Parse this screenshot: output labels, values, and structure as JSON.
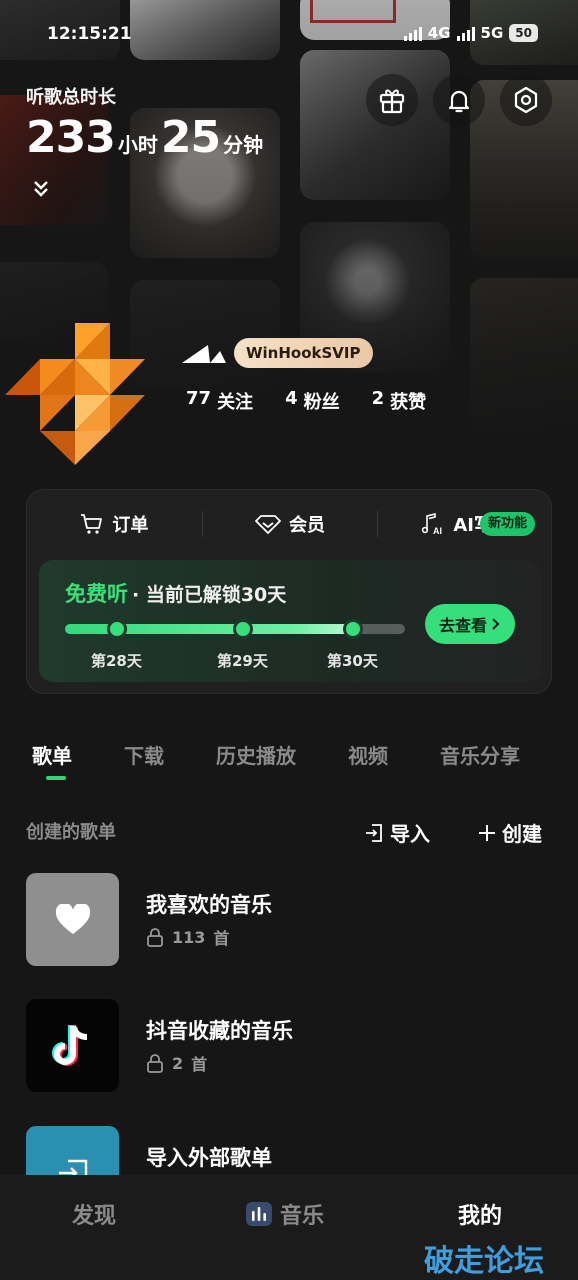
{
  "status_bar": {
    "time": "12:15:21",
    "network_4g": "4G",
    "network_5g": "5G",
    "battery": "50"
  },
  "header": {
    "listen_label": "听歌总时长",
    "hours_value": "233",
    "hours_unit": "小时",
    "minutes_value": "25",
    "minutes_unit": "分钟",
    "icons": [
      "gift-icon",
      "bell-icon",
      "settings-icon"
    ]
  },
  "profile": {
    "vip_badge": "WinHookSVIP",
    "following": {
      "count": "77",
      "label": "关注"
    },
    "fans": {
      "count": "4",
      "label": "粉丝"
    },
    "likes": {
      "count": "2",
      "label": "获赞"
    }
  },
  "services": {
    "items": [
      {
        "label": "订单",
        "icon": "cart-icon"
      },
      {
        "label": "会员",
        "icon": "diamond-icon"
      },
      {
        "label": "AI写歌",
        "icon": "music-ai-icon"
      }
    ],
    "new_tag": "新功能"
  },
  "free_listen": {
    "highlight": "免费听",
    "subtitle": "· 当前已解锁30天",
    "days": [
      "第28天",
      "第29天",
      "第30天"
    ],
    "progress": 0.85,
    "button": "去查看"
  },
  "tabs": [
    "歌单",
    "下载",
    "历史播放",
    "视频",
    "音乐分享"
  ],
  "playlist_section": {
    "title": "创建的歌单",
    "import_label": "导入",
    "create_label": "创建"
  },
  "playlists": [
    {
      "name": "我喜欢的音乐",
      "count": "113",
      "unit": "首"
    },
    {
      "name": "抖音收藏的音乐",
      "count": "2",
      "unit": "首"
    },
    {
      "name": "导入外部歌单"
    }
  ],
  "bottom_nav": [
    "发现",
    "音乐",
    "我的"
  ],
  "watermark": "破走论坛",
  "colors": {
    "accent": "#35e07c",
    "background": "#161616",
    "vip_gold": "#f0d3b4",
    "watermark": "#3e9fe0"
  }
}
